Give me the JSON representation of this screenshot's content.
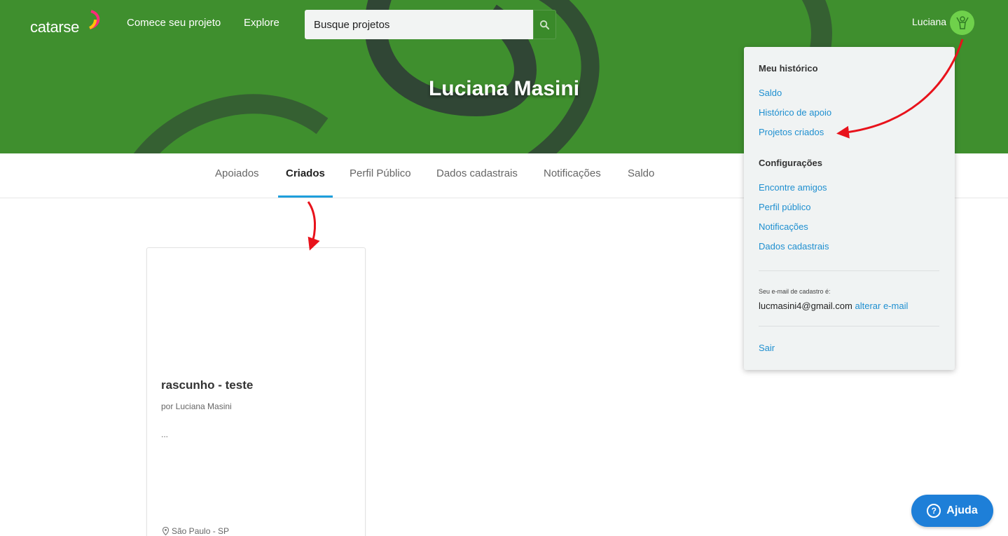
{
  "header": {
    "logo_text": "catarse",
    "nav": [
      {
        "label": "Comece seu projeto"
      },
      {
        "label": "Explore"
      }
    ],
    "search": {
      "value": "Busque projetos"
    },
    "user": {
      "name": "Luciana"
    }
  },
  "profile": {
    "title": "Luciana Masini"
  },
  "tabs": [
    {
      "label": "Apoiados"
    },
    {
      "label": "Criados"
    },
    {
      "label": "Perfil Público"
    },
    {
      "label": "Dados cadastrais"
    },
    {
      "label": "Notificações"
    },
    {
      "label": "Saldo"
    }
  ],
  "active_tab": "Criados",
  "project_card": {
    "title": "rascunho - teste",
    "author": "por Luciana Masini",
    "description": "...",
    "location": "São Paulo - SP"
  },
  "dropdown": {
    "history_heading": "Meu histórico",
    "history_links": [
      {
        "label": "Saldo"
      },
      {
        "label": "Histórico de apoio"
      },
      {
        "label": "Projetos criados"
      }
    ],
    "settings_heading": "Configurações",
    "settings_links": [
      {
        "label": "Encontre amigos"
      },
      {
        "label": "Perfil público"
      },
      {
        "label": "Notificações"
      },
      {
        "label": "Dados cadastrais"
      }
    ],
    "email_caption": "Seu e-mail de cadastro é:",
    "email": "lucmasini4@gmail.com",
    "change_email": "alterar e-mail",
    "logout": "Sair"
  },
  "help": {
    "label": "Ajuda"
  },
  "colors": {
    "hero_green": "#3f8f2e",
    "link_blue": "#1e8fd0",
    "tab_underline": "#1e9fdc",
    "help_blue": "#1e7fd8",
    "annotation_red": "#e8121b"
  }
}
